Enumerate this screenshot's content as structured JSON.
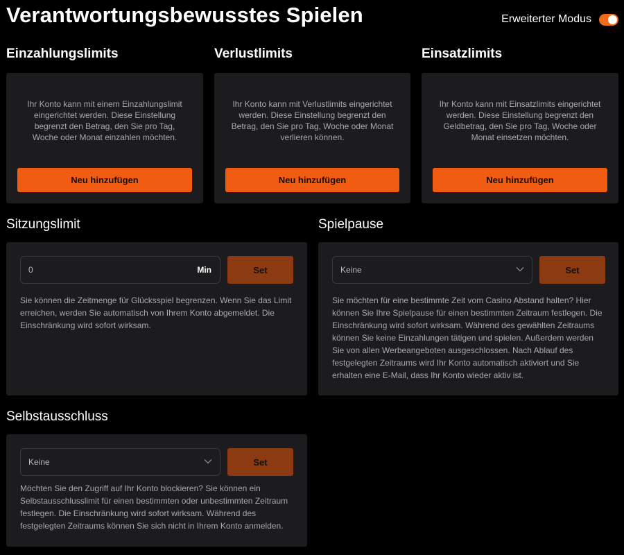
{
  "header": {
    "title": "Verantwortungsbewusstes Spielen",
    "mode_label": "Erweiterter Modus",
    "mode_enabled": true
  },
  "deposit": {
    "title": "Einzahlungslimits",
    "description": "Ihr Konto kann mit einem Einzahlungslimit eingerichtet werden. Diese Einstellung begrenzt den Betrag, den Sie pro Tag, Woche oder Monat einzahlen möchten.",
    "button": "Neu hinzufügen"
  },
  "loss": {
    "title": "Verlustlimits",
    "description": "Ihr Konto kann mit Verlustlimits eingerichtet werden. Diese Einstellung begrenzt den Betrag, den Sie pro Tag, Woche oder Monat verlieren können.",
    "button": "Neu hinzufügen"
  },
  "wager": {
    "title": "Einsatzlimits",
    "description": "Ihr Konto kann mit Einsatzlimits eingerichtet werden. Diese Einstellung begrenzt den Geldbetrag, den Sie pro Tag, Woche oder Monat einsetzen möchten.",
    "button": "Neu hinzufügen"
  },
  "session": {
    "title": "Sitzungslimit",
    "value": "0",
    "unit": "Min",
    "button": "Set",
    "description": "Sie können die Zeitmenge für Glücksspiel begrenzen. Wenn Sie das Limit erreichen, werden Sie automatisch von Ihrem Konto abgemeldet. Die Einschränkung wird sofort wirksam."
  },
  "pause": {
    "title": "Spielpause",
    "selected": "Keine",
    "button": "Set",
    "description": "Sie möchten für eine bestimmte Zeit vom Casino Abstand halten? Hier können Sie Ihre Spielpause für einen bestimmten Zeitraum festlegen. Die Einschränkung wird sofort wirksam. Während des gewählten Zeitraums können Sie keine Einzahlungen tätigen und spielen. Außerdem werden Sie von allen Werbeangeboten ausgeschlossen. Nach Ablauf des festgelegten Zeitraums wird Ihr Konto automatisch aktiviert und Sie erhalten eine E-Mail, dass Ihr Konto wieder aktiv ist."
  },
  "exclusion": {
    "title": "Selbstausschluss",
    "selected": "Keine",
    "button": "Set",
    "description": "Möchten Sie den Zugriff auf Ihr Konto blockieren? Sie können ein Selbstausschlusslimit für einen bestimmten oder unbestimmten Zeitraum festlegen. Die Einschränkung wird sofort wirksam. Während des festgelegten Zeitraums können Sie sich nicht in Ihrem Konto anmelden."
  },
  "colors": {
    "accent": "#ef5c12",
    "set_button": "#8b3a12",
    "card_bg": "#1c1c1e",
    "toggle_on": "#ef6a1a"
  }
}
